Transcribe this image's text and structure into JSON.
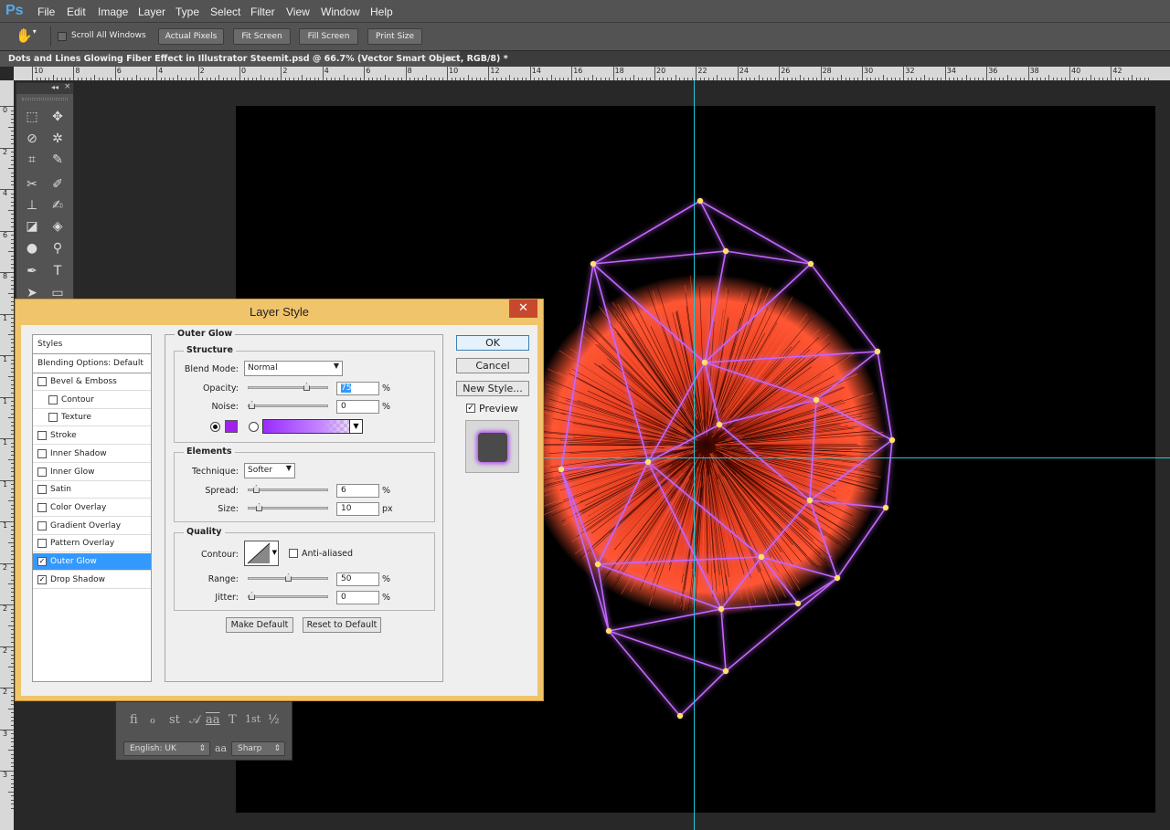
{
  "app": {
    "logo": "Ps"
  },
  "menubar": {
    "items": [
      "File",
      "Edit",
      "Image",
      "Layer",
      "Type",
      "Select",
      "Filter",
      "View",
      "Window",
      "Help"
    ]
  },
  "options_bar": {
    "hand_tool_icon": "hand-icon",
    "scroll_all_windows": {
      "label": "Scroll All Windows",
      "checked": false
    },
    "buttons": [
      "Actual Pixels",
      "Fit Screen",
      "Fill Screen",
      "Print Size"
    ]
  },
  "document_tab": {
    "title": "Dots and Lines Glowing Fiber Effect in Illustrator Steemit.psd @ 66.7% (Vector Smart Object, RGB/8) *",
    "close": "×"
  },
  "rulers": {
    "horizontal": [
      "10",
      "8",
      "6",
      "4",
      "2",
      "0",
      "2",
      "4",
      "6",
      "8",
      "10",
      "12",
      "14",
      "16",
      "18",
      "20",
      "22",
      "24",
      "26",
      "28",
      "30",
      "32",
      "34",
      "36",
      "38",
      "40",
      "42"
    ],
    "vertical": [
      "0",
      "2",
      "4",
      "6",
      "8",
      "1",
      "1",
      "1",
      "1",
      "1",
      "1",
      "2",
      "2",
      "2",
      "2",
      "3",
      "3"
    ]
  },
  "toolbox": {
    "collapse": "◂◂",
    "close": "×"
  },
  "character_panel": {
    "glyphs": [
      "fi",
      "ℴ",
      "st",
      "𝒜",
      "aa",
      "T",
      "1st",
      "½"
    ],
    "language": "English: UK",
    "aa_icon": "aa",
    "antialias": "Sharp"
  },
  "dialog": {
    "title": "Layer Style",
    "close": "✕",
    "styles_list": [
      {
        "label": "Styles",
        "type": "header"
      },
      {
        "label": "Blending Options: Default",
        "type": "header"
      },
      {
        "label": "Bevel & Emboss",
        "checked": false
      },
      {
        "label": "Contour",
        "checked": false,
        "indent": true
      },
      {
        "label": "Texture",
        "checked": false,
        "indent": true
      },
      {
        "label": "Stroke",
        "checked": false
      },
      {
        "label": "Inner Shadow",
        "checked": false
      },
      {
        "label": "Inner Glow",
        "checked": false
      },
      {
        "label": "Satin",
        "checked": false
      },
      {
        "label": "Color Overlay",
        "checked": false
      },
      {
        "label": "Gradient Overlay",
        "checked": false
      },
      {
        "label": "Pattern Overlay",
        "checked": false
      },
      {
        "label": "Outer Glow",
        "checked": true,
        "selected": true
      },
      {
        "label": "Drop Shadow",
        "checked": true
      }
    ],
    "outer_glow": {
      "title": "Outer Glow",
      "structure": {
        "title": "Structure",
        "blend_mode_label": "Blend Mode:",
        "blend_mode": "Normal",
        "opacity_label": "Opacity:",
        "opacity": "75",
        "opacity_level": 75,
        "noise_label": "Noise:",
        "noise": "0",
        "noise_level": 0,
        "percent": "%",
        "glow_color": "#a020f0"
      },
      "elements": {
        "title": "Elements",
        "technique_label": "Technique:",
        "technique": "Softer",
        "spread_label": "Spread:",
        "spread": "6",
        "spread_level": 6,
        "size_label": "Size:",
        "size": "10",
        "size_level": 10,
        "percent": "%",
        "px": "px"
      },
      "quality": {
        "title": "Quality",
        "contour_label": "Contour:",
        "anti_aliased": {
          "label": "Anti-aliased",
          "checked": false
        },
        "range_label": "Range:",
        "range": "50",
        "range_level": 50,
        "jitter_label": "Jitter:",
        "jitter": "0",
        "jitter_level": 0,
        "percent": "%"
      },
      "make_default": "Make Default",
      "reset_default": "Reset to Default"
    },
    "buttons": {
      "ok": "OK",
      "cancel": "Cancel",
      "new_style": "New Style..."
    },
    "preview": {
      "label": "Preview",
      "checked": true
    }
  },
  "colors": {
    "glow": "#c466ff",
    "node": "#ffe066",
    "fiber": "#ff4a26",
    "guide": "#20c8d8"
  }
}
